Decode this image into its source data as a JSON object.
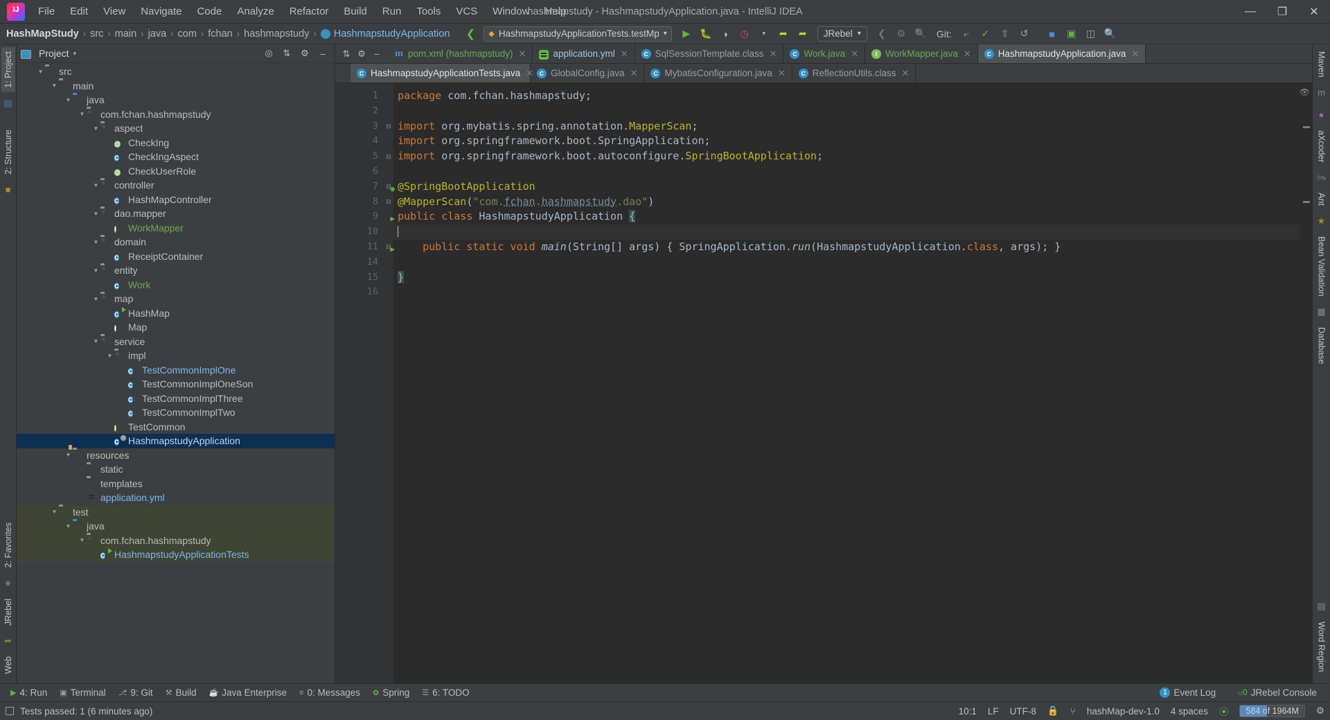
{
  "window": {
    "title": "hashmapstudy - HashmapstudyApplication.java - IntelliJ IDEA",
    "minimize": "—",
    "maximize": "❐",
    "close": "✕"
  },
  "menu": [
    "File",
    "Edit",
    "View",
    "Navigate",
    "Code",
    "Analyze",
    "Refactor",
    "Build",
    "Run",
    "Tools",
    "VCS",
    "Window",
    "Help"
  ],
  "breadcrumb": {
    "project": "HashMapStudy",
    "items": [
      "src",
      "main",
      "java",
      "com",
      "fchan",
      "hashmapstudy"
    ],
    "current": "HashmapstudyApplication",
    "separator": "›"
  },
  "toolbar": {
    "run_config": "HashmapstudyApplicationTests.testMp",
    "run_config_caret": "▾",
    "jrebel": "JRebel",
    "jrebel_caret": "▾",
    "git_label": "Git:",
    "buttons": [
      "run-button",
      "debug-button",
      "run-coverage-button",
      "profiler-button",
      "jrebel-run-button",
      "jrebel-debug-button"
    ]
  },
  "project_panel": {
    "title": "Project",
    "caret": "▾",
    "tree": [
      {
        "label": "src",
        "depth": 1,
        "type": "folder",
        "arrow": "open"
      },
      {
        "label": "main",
        "depth": 2,
        "type": "folder",
        "arrow": "open"
      },
      {
        "label": "java",
        "depth": 3,
        "type": "folder-blue",
        "arrow": "open"
      },
      {
        "label": "com.fchan.hashmapstudy",
        "depth": 4,
        "type": "package",
        "arrow": "open"
      },
      {
        "label": "aspect",
        "depth": 5,
        "type": "package",
        "arrow": "open"
      },
      {
        "label": "CheckIng",
        "depth": 6,
        "type": "annotation",
        "arrow": "none"
      },
      {
        "label": "CheckIngAspect",
        "depth": 6,
        "type": "class",
        "arrow": "none"
      },
      {
        "label": "CheckUserRole",
        "depth": 6,
        "type": "annotation",
        "arrow": "none"
      },
      {
        "label": "controller",
        "depth": 5,
        "type": "package",
        "arrow": "open"
      },
      {
        "label": "HashMapController",
        "depth": 6,
        "type": "class",
        "arrow": "none"
      },
      {
        "label": "dao.mapper",
        "depth": 5,
        "type": "package",
        "arrow": "open"
      },
      {
        "label": "WorkMapper",
        "depth": 6,
        "type": "interface",
        "arrow": "none",
        "color": "green"
      },
      {
        "label": "domain",
        "depth": 5,
        "type": "package",
        "arrow": "open"
      },
      {
        "label": "ReceiptContainer",
        "depth": 6,
        "type": "class",
        "arrow": "none"
      },
      {
        "label": "entity",
        "depth": 5,
        "type": "package",
        "arrow": "open"
      },
      {
        "label": "Work",
        "depth": 6,
        "type": "class",
        "arrow": "none",
        "color": "green"
      },
      {
        "label": "map",
        "depth": 5,
        "type": "package",
        "arrow": "open"
      },
      {
        "label": "HashMap",
        "depth": 6,
        "type": "class-run",
        "arrow": "none"
      },
      {
        "label": "Map",
        "depth": 6,
        "type": "interface",
        "arrow": "none"
      },
      {
        "label": "service",
        "depth": 5,
        "type": "package",
        "arrow": "open"
      },
      {
        "label": "impl",
        "depth": 6,
        "type": "package",
        "arrow": "open"
      },
      {
        "label": "TestCommonImplOne",
        "depth": 7,
        "type": "class",
        "arrow": "none",
        "color": "blue"
      },
      {
        "label": "TestCommonImplOneSon",
        "depth": 7,
        "type": "class",
        "arrow": "none"
      },
      {
        "label": "TestCommonImplThree",
        "depth": 7,
        "type": "class",
        "arrow": "none"
      },
      {
        "label": "TestCommonImplTwo",
        "depth": 7,
        "type": "class",
        "arrow": "none"
      },
      {
        "label": "TestCommon",
        "depth": 6,
        "type": "interface",
        "arrow": "none"
      },
      {
        "label": "HashmapstudyApplication",
        "depth": 6,
        "type": "class-boot",
        "arrow": "none",
        "selected": true
      },
      {
        "label": "resources",
        "depth": 3,
        "type": "folder-res",
        "arrow": "open"
      },
      {
        "label": "static",
        "depth": 4,
        "type": "folder",
        "arrow": "none"
      },
      {
        "label": "templates",
        "depth": 4,
        "type": "folder",
        "arrow": "none"
      },
      {
        "label": "application.yml",
        "depth": 4,
        "type": "yml",
        "arrow": "none",
        "color": "blue"
      },
      {
        "label": "test",
        "depth": 2,
        "type": "folder",
        "arrow": "open",
        "testpath": true
      },
      {
        "label": "java",
        "depth": 3,
        "type": "folder-blue",
        "arrow": "open",
        "testpath": true
      },
      {
        "label": "com.fchan.hashmapstudy",
        "depth": 4,
        "type": "package",
        "arrow": "open",
        "testpath": true
      },
      {
        "label": "HashmapstudyApplicationTests",
        "depth": 5,
        "type": "class-run",
        "arrow": "none",
        "testpath": true,
        "color": "blue"
      }
    ]
  },
  "editor": {
    "tabs_row1": [
      {
        "label": "pom.xml (hashmapstudy)",
        "icon": "maven-icon",
        "active": false,
        "color": "green"
      },
      {
        "label": "application.yml",
        "icon": "yaml-icon",
        "active": false,
        "color": "blue"
      },
      {
        "label": "SqlSessionTemplate.class",
        "icon": "class-icon",
        "active": false
      },
      {
        "label": "Work.java",
        "icon": "class-icon",
        "active": false,
        "color": "green"
      },
      {
        "label": "WorkMapper.java",
        "icon": "interface-icon",
        "active": false,
        "color": "green"
      },
      {
        "label": "HashmapstudyApplication.java",
        "icon": "springboot-icon",
        "active": true,
        "color": "blue"
      }
    ],
    "tabs_row2": [
      {
        "label": "HashmapstudyApplicationTests.java",
        "icon": "class-icon",
        "active": true,
        "color": "blue"
      },
      {
        "label": "GlobalConfig.java",
        "icon": "class-icon",
        "active": false
      },
      {
        "label": "MybatisConfiguration.java",
        "icon": "class-icon",
        "active": false
      },
      {
        "label": "ReflectionUtils.class",
        "icon": "class-icon",
        "active": false
      }
    ],
    "line_numbers": [
      "1",
      "2",
      "3",
      "4",
      "5",
      "6",
      "7",
      "8",
      "9",
      "10",
      "11",
      "14",
      "15",
      "16"
    ],
    "lines": [
      {
        "n": "1",
        "html": "<span class='kw'>package</span> com.fchan.hashmapstudy;"
      },
      {
        "n": "2",
        "html": ""
      },
      {
        "n": "3",
        "html": "<span class='kw'>import</span> org.mybatis.spring.annotation.<span class='ann'>MapperScan</span>;"
      },
      {
        "n": "4",
        "html": "<span class='kw'>import</span> org.springframework.boot.SpringApplication;"
      },
      {
        "n": "5",
        "html": "<span class='kw'>import</span> org.springframework.boot.autoconfigure.<span class='ann'>SpringBootApplication</span>;"
      },
      {
        "n": "6",
        "html": ""
      },
      {
        "n": "7",
        "html": "<span class='ann'>@SpringBootApplication</span>"
      },
      {
        "n": "8",
        "html": "<span class='ann'>@MapperScan</span>(<span class='str'>\"com.</span><span class='lnk'>fchan</span><span class='str'>.</span><span class='lnk'>hashmapstudy</span><span class='str'>.dao\"</span>)"
      },
      {
        "n": "9",
        "html": "<span class='kw'>public class</span> <span class='cls-n'>HashmapstudyApplication</span> <span class='hl-brace'>{</span>"
      },
      {
        "n": "10",
        "html": "<span class='caret-bar'></span>"
      },
      {
        "n": "11",
        "html": "    <span class='kw'>public static void</span> <span class='static-m'>main</span>(String[] args) { SpringApplication.<span class='static-m'>run</span>(HashmapstudyApplication.<span class='kw'>class</span>, args); }"
      },
      {
        "n": "14",
        "html": ""
      },
      {
        "n": "15",
        "html": "<span class='hl-brace'>}</span>"
      },
      {
        "n": "16",
        "html": ""
      }
    ]
  },
  "tool_windows": [
    {
      "label": "4: Run",
      "icon": "run-icon"
    },
    {
      "label": "Terminal",
      "icon": "terminal-icon"
    },
    {
      "label": "9: Git",
      "icon": "git-icon"
    },
    {
      "label": "Build",
      "icon": "build-icon"
    },
    {
      "label": "Java Enterprise",
      "icon": "java-icon"
    },
    {
      "label": "0: Messages",
      "icon": "messages-icon"
    },
    {
      "label": "Spring",
      "icon": "spring-icon"
    },
    {
      "label": "6: TODO",
      "icon": "todo-icon"
    }
  ],
  "tool_windows_right": [
    {
      "label": "Event Log",
      "badge": "1"
    },
    {
      "label": "JRebel Console",
      "icon": "jrebel-icon"
    }
  ],
  "right_strip": [
    "Maven",
    "aXcoder",
    "Ant",
    "Bean Validation",
    "Database",
    "Word Region"
  ],
  "left_strip": [
    "1: Project",
    "2: Structure",
    "2: Favorites",
    "JRebel",
    "Web"
  ],
  "status_bar": {
    "message": "Tests passed: 1 (6 minutes ago)",
    "caret_position": "10:1",
    "line_separator": "LF",
    "encoding": "UTF-8",
    "branch": "hashMap-dev-1.0",
    "indent": "4 spaces",
    "memory": "584 of 1964M"
  }
}
